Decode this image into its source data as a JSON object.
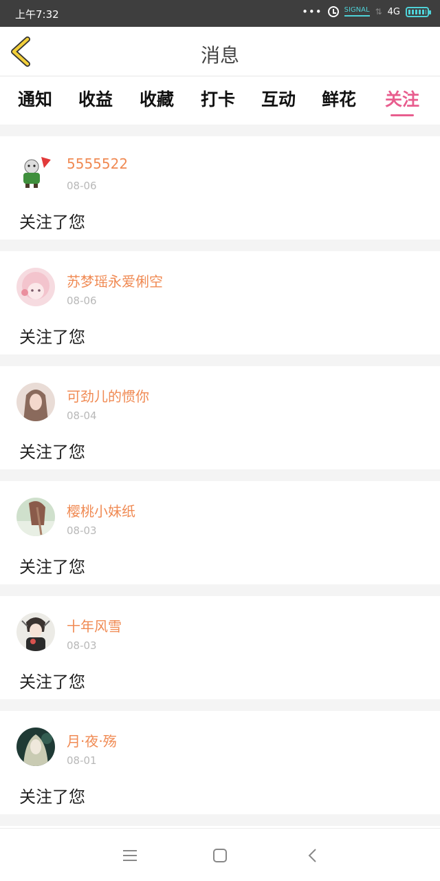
{
  "status_bar": {
    "time": "上午7:32",
    "dots": "•••",
    "signal_label": "SIGNAL",
    "network": "4G"
  },
  "header": {
    "title": "消息"
  },
  "tabs": [
    {
      "label": "通知"
    },
    {
      "label": "收益"
    },
    {
      "label": "收藏"
    },
    {
      "label": "打卡"
    },
    {
      "label": "互动"
    },
    {
      "label": "鲜花"
    },
    {
      "label": "关注",
      "active": true
    }
  ],
  "items": [
    {
      "name": "5555522",
      "date": "08-06",
      "message": "关注了您"
    },
    {
      "name": "苏梦瑶永爱俐空",
      "date": "08-06",
      "message": "关注了您"
    },
    {
      "name": "可劲儿的惯你",
      "date": "08-04",
      "message": "关注了您"
    },
    {
      "name": "樱桃小妹纸",
      "date": "08-03",
      "message": "关注了您"
    },
    {
      "name": "十年风雪",
      "date": "08-03",
      "message": "关注了您"
    },
    {
      "name": "月·夜·殇",
      "date": "08-01",
      "message": "关注了您"
    }
  ],
  "colors": {
    "accent": "#e85d8e",
    "name": "#f08a53",
    "back_icon": "#f2cf3a",
    "status_bar": "#3e3e3e"
  },
  "icons": {
    "back": "chevron-left-icon",
    "menu": "menu-icon",
    "home": "square-home-icon",
    "nav_back": "nav-back-icon"
  }
}
